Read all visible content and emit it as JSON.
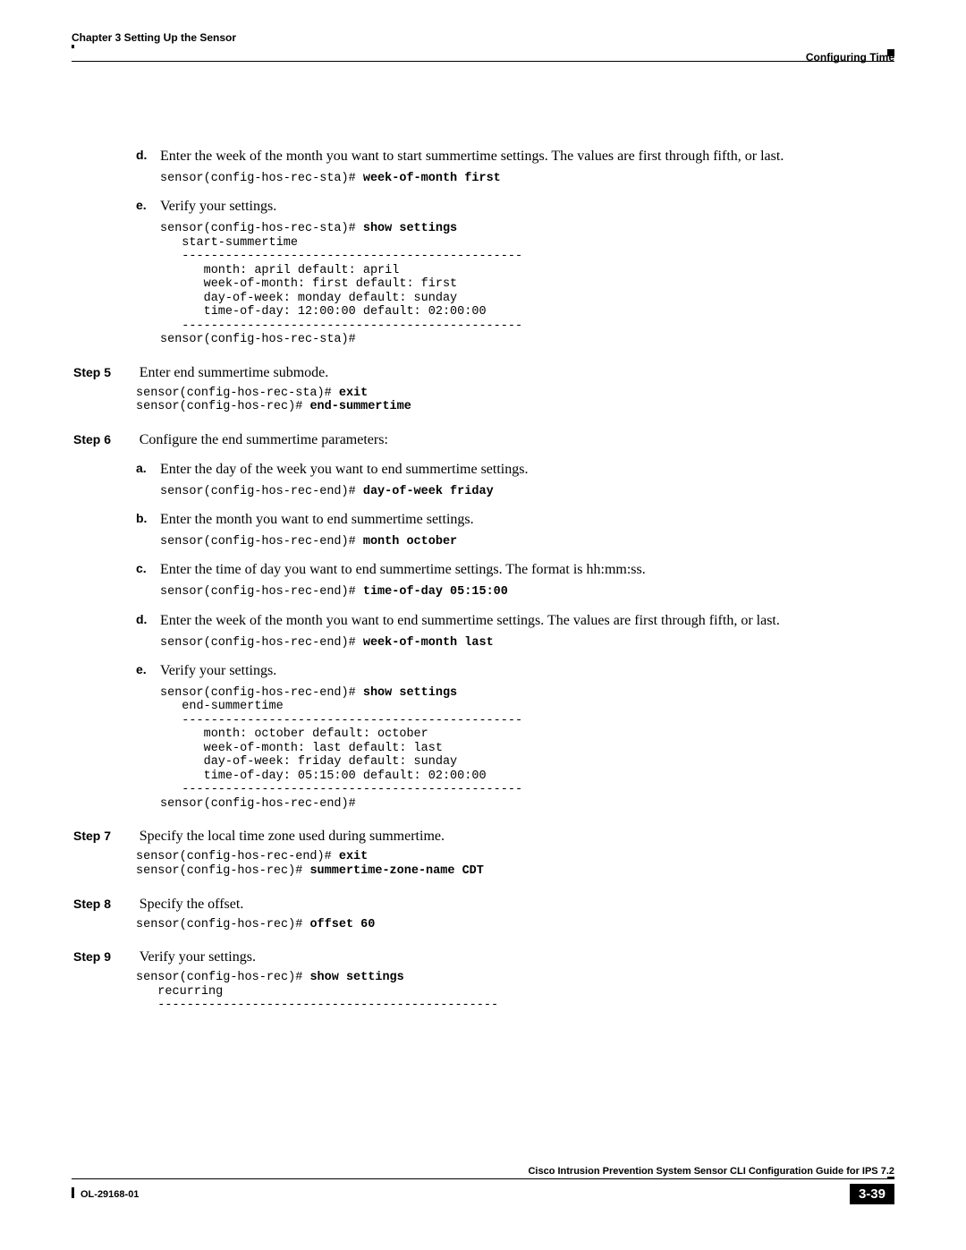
{
  "header": {
    "chapter": "Chapter 3      Setting Up the Sensor",
    "section": "Configuring Time"
  },
  "subs_top": {
    "d": {
      "text": "Enter the week of the month you want to start summertime settings. The values are first through fifth, or last.",
      "code_prompt": "sensor(config-hos-rec-sta)# ",
      "code_cmd": "week-of-month first"
    },
    "e": {
      "text": "Verify your settings.",
      "code": "sensor(config-hos-rec-sta)# ",
      "code_cmd": "show settings",
      "code_body": "   start-summertime\n   -----------------------------------------------\n      month: april default: april\n      week-of-month: first default: first\n      day-of-week: monday default: sunday\n      time-of-day: 12:00:00 default: 02:00:00\n   -----------------------------------------------\nsensor(config-hos-rec-sta)#"
    }
  },
  "step5": {
    "label": "Step 5",
    "text": "Enter end summertime submode.",
    "code_l1p": "sensor(config-hos-rec-sta)# ",
    "code_l1c": "exit",
    "code_l2p": "sensor(config-hos-rec)# ",
    "code_l2c": "end-summertime"
  },
  "step6": {
    "label": "Step 6",
    "text": "Configure the end summertime parameters:",
    "a": {
      "text": "Enter the day of the week you want to end summertime settings.",
      "p": "sensor(config-hos-rec-end)# ",
      "c": "day-of-week friday"
    },
    "b": {
      "text": "Enter the month you want to end summertime settings.",
      "p": "sensor(config-hos-rec-end)# ",
      "c": "month october"
    },
    "c": {
      "text": "Enter the time of day you want to end summertime settings. The format is hh:mm:ss.",
      "p": "sensor(config-hos-rec-end)# ",
      "c": "time-of-day 05:15:00"
    },
    "d": {
      "text": "Enter the week of the month you want to end summertime settings. The values are first through fifth, or last.",
      "p": "sensor(config-hos-rec-end)# ",
      "c": "week-of-month last"
    },
    "e": {
      "text": "Verify your settings.",
      "p": "sensor(config-hos-rec-end)# ",
      "c": "show settings",
      "body": "   end-summertime\n   -----------------------------------------------\n      month: october default: october\n      week-of-month: last default: last\n      day-of-week: friday default: sunday\n      time-of-day: 05:15:00 default: 02:00:00\n   -----------------------------------------------\nsensor(config-hos-rec-end)#"
    }
  },
  "step7": {
    "label": "Step 7",
    "text": "Specify the local time zone used during summertime.",
    "l1p": "sensor(config-hos-rec-end)# ",
    "l1c": "exit",
    "l2p": "sensor(config-hos-rec)# ",
    "l2c": "summertime-zone-name CDT"
  },
  "step8": {
    "label": "Step 8",
    "text": "Specify the offset.",
    "p": "sensor(config-hos-rec)# ",
    "c": "offset 60"
  },
  "step9": {
    "label": "Step 9",
    "text": "Verify your settings.",
    "p": "sensor(config-hos-rec)# ",
    "c": "show settings",
    "body": "   recurring\n   -----------------------------------------------"
  },
  "footer": {
    "title": "Cisco Intrusion Prevention System Sensor CLI Configuration Guide for IPS 7.2",
    "doc": "OL-29168-01",
    "page": "3-39"
  }
}
